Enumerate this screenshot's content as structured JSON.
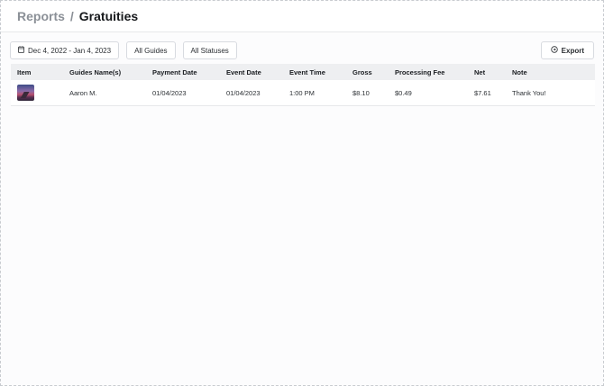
{
  "header": {
    "parent": "Reports",
    "separator": "/",
    "current": "Gratuities"
  },
  "toolbar": {
    "date_range": "Dec 4, 2022 - Jan 4, 2023",
    "guides_filter": "All Guides",
    "status_filter": "All Statuses",
    "export_label": "Export"
  },
  "table": {
    "columns": [
      "Item",
      "Guides Name(s)",
      "Payment Date",
      "Event Date",
      "Event Time",
      "Gross",
      "Processing Fee",
      "Net",
      "Note"
    ],
    "rows": [
      [
        "",
        "Aaron M.",
        "01/04/2023",
        "01/04/2023",
        "1:00 PM",
        "$8.10",
        "$0.49",
        "$7.61",
        "Thank You!"
      ]
    ]
  }
}
